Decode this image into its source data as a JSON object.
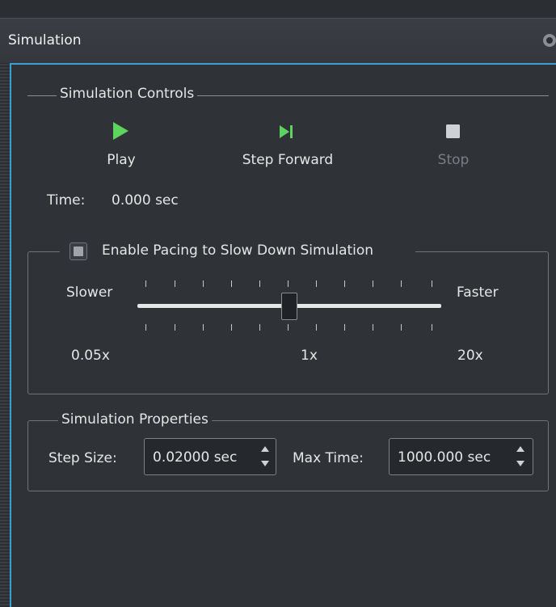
{
  "window": {
    "title": "Simulation"
  },
  "controls": {
    "group_title": "Simulation Controls",
    "play_label": "Play",
    "step_label": "Step Forward",
    "stop_label": "Stop",
    "time_label": "Time:",
    "time_value": "0.000 sec"
  },
  "pacing": {
    "checkbox_label": "Enable Pacing to Slow Down Simulation",
    "enabled": false,
    "slower_label": "Slower",
    "faster_label": "Faster",
    "min_label": "0.05x",
    "mid_label": "1x",
    "max_label": "20x",
    "slider_value": "1x"
  },
  "properties": {
    "group_title": "Simulation Properties",
    "step_size_label": "Step Size:",
    "step_size_value": "0.02000 sec",
    "max_time_label": "Max Time:",
    "max_time_value": "1000.000 sec"
  },
  "colors": {
    "accent": "#3d9fd8",
    "play_icon": "#5fd35f",
    "background": "#2f3236"
  },
  "icons": {
    "play": "play-icon",
    "step": "step-forward-icon",
    "stop": "stop-icon",
    "close": "close-icon"
  }
}
